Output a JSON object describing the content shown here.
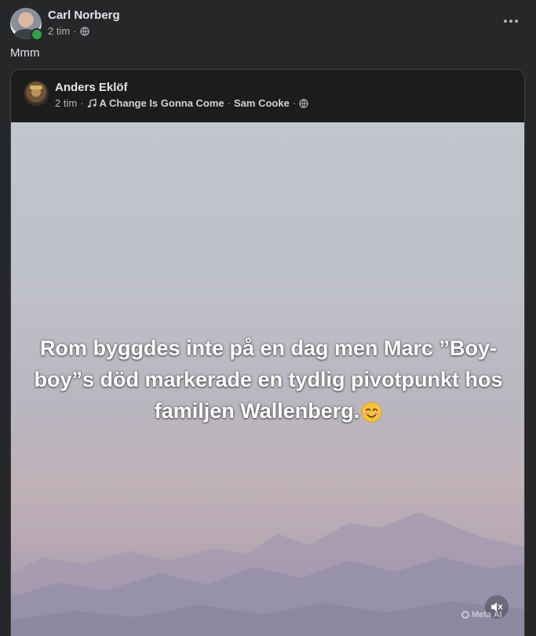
{
  "post": {
    "author": "Carl Norberg",
    "time": "2 tim",
    "separator": "·",
    "text": "Mmm"
  },
  "shared_post": {
    "author": "Anders Eklöf",
    "time": "2 tim",
    "separator": "·",
    "song": "A Change Is Gonna Come",
    "artist": "Sam Cooke",
    "overlay_text": "Rom byggdes inte på en dag men Marc ”Boy-boy”s död markerade en tydlig pivotpunkt hos familjen Wallenberg.",
    "watermark": "Meta AI"
  },
  "icons": {
    "privacy": "globe-icon",
    "more": "more-options-icon",
    "music": "music-note-icon",
    "mute": "speaker-muted-icon",
    "emoji": "smiling-face-emoji"
  },
  "colors": {
    "background": "#252728",
    "online": "#31a24c",
    "text_primary": "#e4e6eb",
    "text_secondary": "#b0b3b8"
  }
}
